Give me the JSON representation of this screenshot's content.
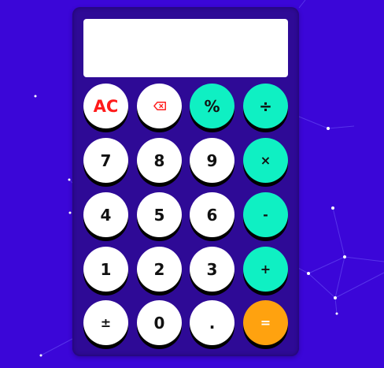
{
  "display": {
    "value": ""
  },
  "keys": {
    "ac": "AC",
    "backspace_icon": "backspace-icon",
    "percent": "%",
    "divide": "÷",
    "seven": "7",
    "eight": "8",
    "nine": "9",
    "multiply": "×",
    "four": "4",
    "five": "5",
    "six": "6",
    "minus": "-",
    "one": "1",
    "two": "2",
    "three": "3",
    "plus": "+",
    "plus_minus": "±",
    "zero": "0",
    "decimal": ".",
    "equals": "="
  },
  "colors": {
    "background": "#3b06d8",
    "calculator_body": "#2e0a96",
    "number_key": "#ffffff",
    "operator_key": "#0ff0c3",
    "equals_key": "#ffa20f",
    "ac_text": "#ff1a1a",
    "key_shadow": "#000000"
  }
}
